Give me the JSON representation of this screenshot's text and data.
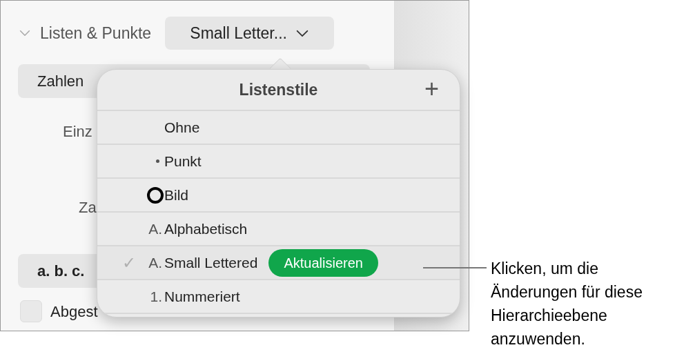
{
  "section": {
    "title": "Listen & Punkte",
    "expanded": true,
    "style_dropdown": "Small Letter..."
  },
  "panel_rows": [
    {
      "kind": "button",
      "label": "Zahlen"
    },
    {
      "kind": "label",
      "label": "Einz"
    },
    {
      "kind": "label",
      "label": "Za"
    },
    {
      "kind": "button",
      "label": "a. b. c."
    },
    {
      "kind": "checkbox",
      "label": "Abgest",
      "checked": false
    }
  ],
  "popover": {
    "title": "Listenstile",
    "add": "+",
    "check_mark": "✓",
    "items": [
      {
        "kind": "none",
        "label": "Ohne",
        "checked": false
      },
      {
        "kind": "bullet",
        "label": "Punkt",
        "checked": false
      },
      {
        "kind": "image",
        "label": "Bild",
        "checked": false
      },
      {
        "kind": "text",
        "marker": "A.",
        "label": "Alphabetisch",
        "checked": false
      },
      {
        "kind": "text",
        "marker": "A.",
        "label": "Small Lettered",
        "checked": true,
        "update_button": "Aktualisieren"
      },
      {
        "kind": "text",
        "marker": "1.",
        "label": "Nummeriert",
        "checked": false
      }
    ]
  },
  "callout": "Klicken, um die\nÄnderungen für diese\nHierarchieebene\nanzuwenden."
}
